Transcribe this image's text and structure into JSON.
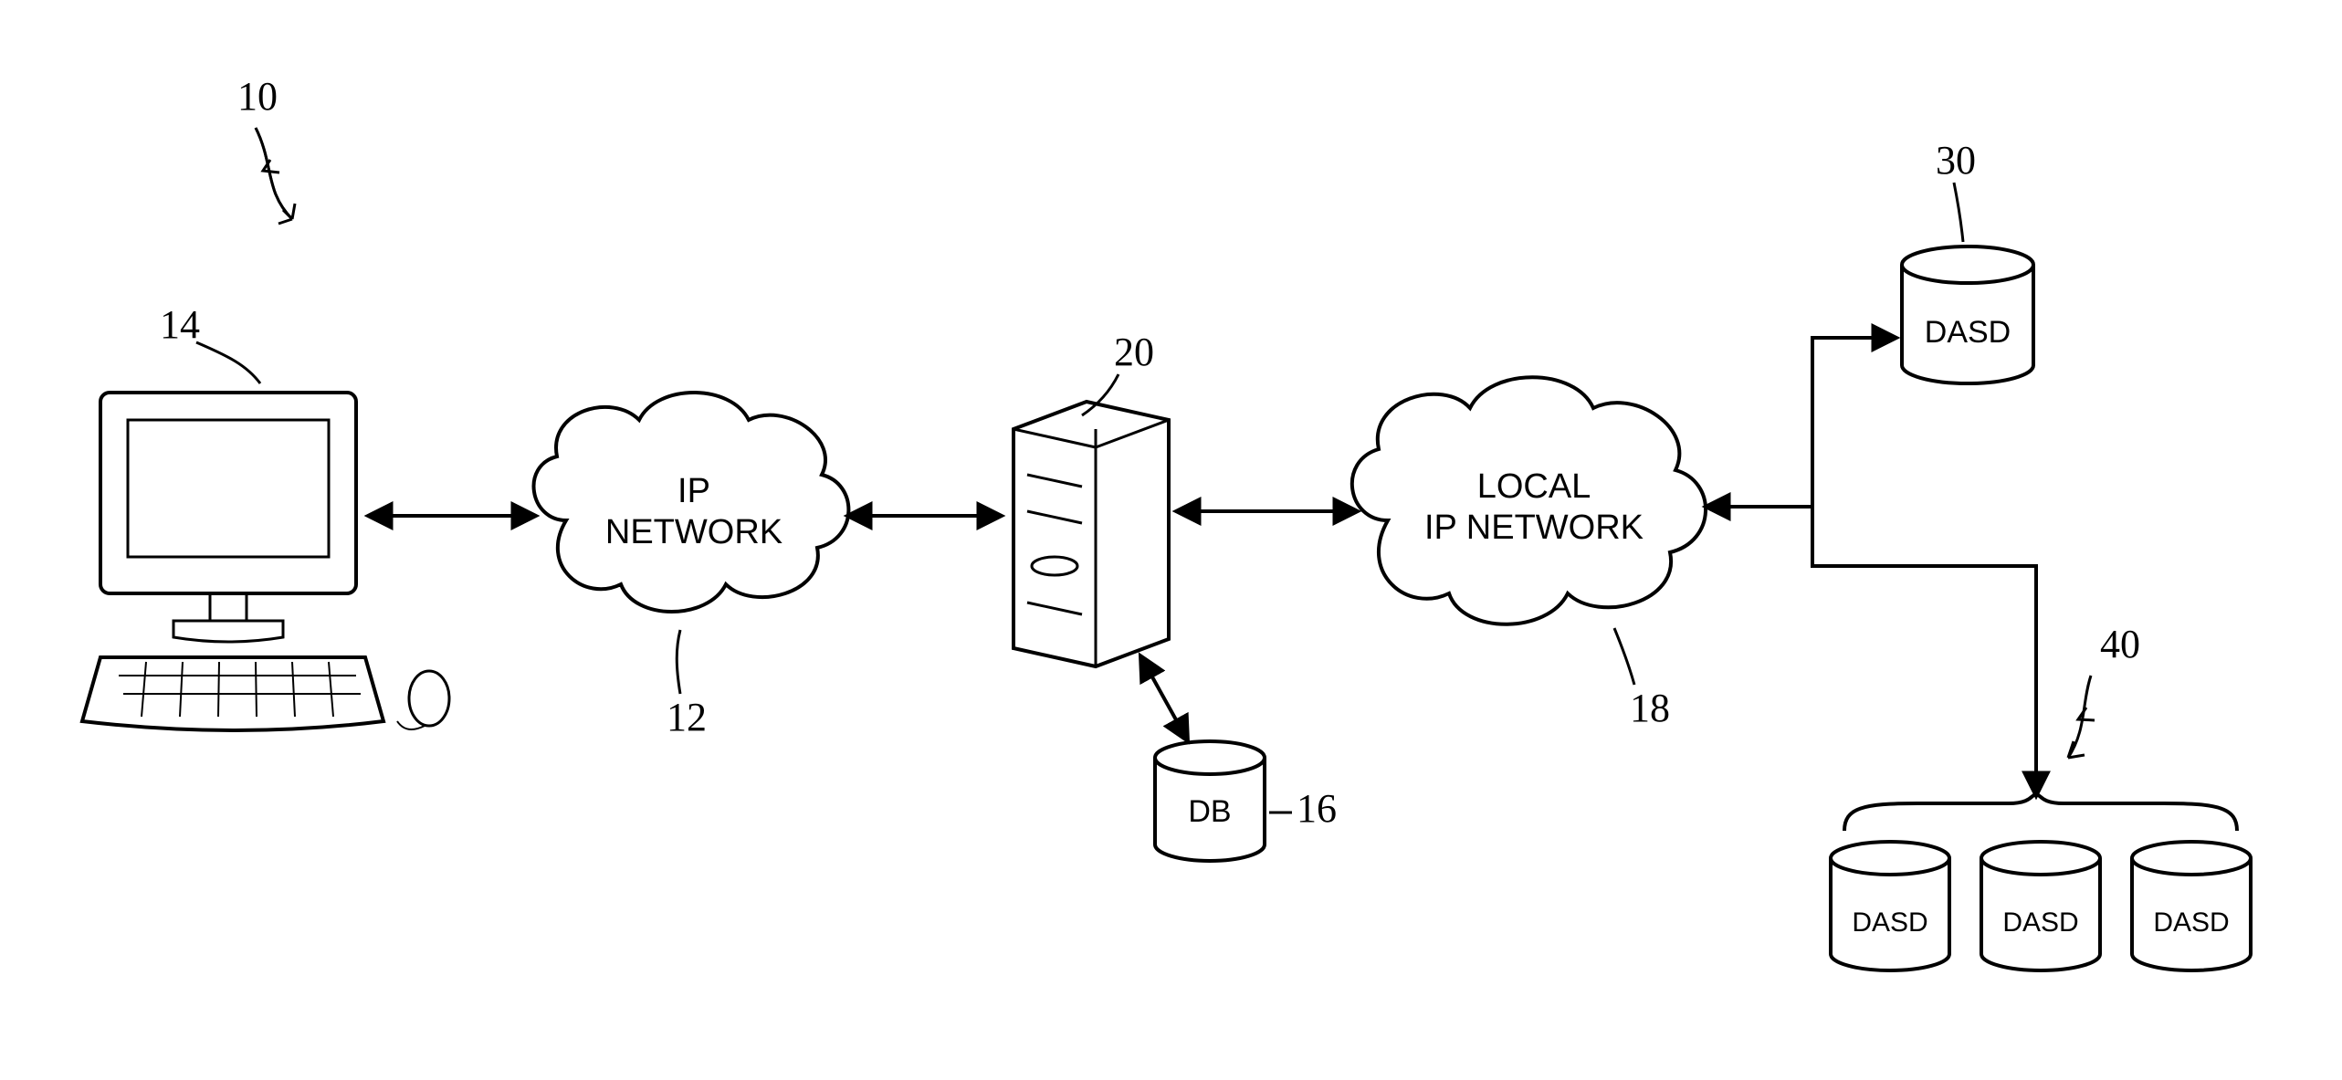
{
  "chart_data": {
    "type": "diagram",
    "title": "Network storage architecture (patent figure style)",
    "nodes": [
      {
        "id": "pc",
        "ref": "14",
        "kind": "workstation",
        "label": ""
      },
      {
        "id": "ipnet",
        "ref": "12",
        "kind": "cloud",
        "label": "IP\nNETWORK"
      },
      {
        "id": "server",
        "ref": "20",
        "kind": "server",
        "label": ""
      },
      {
        "id": "db",
        "ref": "16",
        "kind": "cylinder",
        "label": "DB"
      },
      {
        "id": "localipnet",
        "ref": "18",
        "kind": "cloud",
        "label": "LOCAL\nIP NETWORK"
      },
      {
        "id": "dasd_top",
        "ref": "30",
        "kind": "cylinder",
        "label": "DASD"
      },
      {
        "id": "dasd_group",
        "ref": "40",
        "kind": "cylinder-group",
        "label": "DASD",
        "count": 3
      }
    ],
    "edges": [
      {
        "from": "pc",
        "to": "ipnet",
        "bidir": true
      },
      {
        "from": "ipnet",
        "to": "server",
        "bidir": true
      },
      {
        "from": "server",
        "to": "db",
        "bidir": true
      },
      {
        "from": "server",
        "to": "localipnet",
        "bidir": true
      },
      {
        "from": "localipnet",
        "to": "dasd_top",
        "bidir": true
      },
      {
        "from": "localipnet",
        "to": "dasd_group",
        "bidir": true
      }
    ],
    "refs": {
      "overall": "10"
    }
  },
  "labels": {
    "ref10": "10",
    "ref14": "14",
    "ref12": "12",
    "ref20": "20",
    "ref16": "16",
    "ref18": "18",
    "ref30": "30",
    "ref40": "40",
    "ip_l1": "IP",
    "ip_l2": "NETWORK",
    "local_l1": "LOCAL",
    "local_l2": "IP NETWORK",
    "db": "DB",
    "dasd": "DASD"
  }
}
